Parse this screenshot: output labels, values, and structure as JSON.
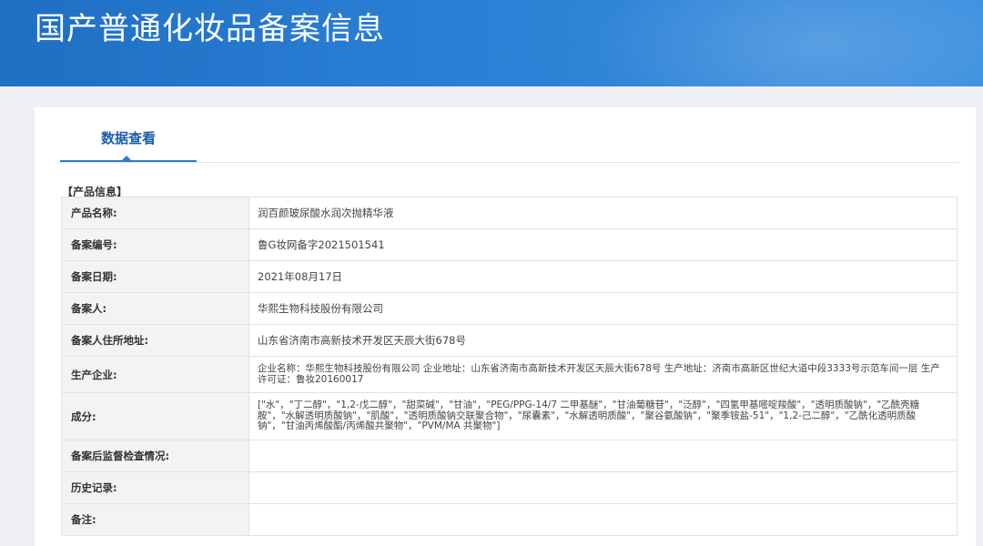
{
  "header": {
    "title": "国产普通化妆品备案信息"
  },
  "tabs": [
    {
      "label": "数据查看"
    }
  ],
  "section": {
    "title": "【产品信息】"
  },
  "rows": [
    {
      "label": "产品名称:",
      "value": "润百颜玻尿酸水润次抛精华液"
    },
    {
      "label": "备案编号:",
      "value": "鲁G妆网备字2021501541"
    },
    {
      "label": "备案日期:",
      "value": "2021年08月17日"
    },
    {
      "label": "备案人:",
      "value": "华熙生物科技股份有限公司"
    },
    {
      "label": "备案人住所地址:",
      "value": "山东省济南市高新技术开发区天辰大街678号"
    },
    {
      "label": "生产企业:",
      "value": "企业名称：华熙生物科技股份有限公司 企业地址：山东省济南市高新技术开发区天辰大街678号 生产地址：济南市高新区世纪大道中段3333号示范车间一层 生产许可证：鲁妆20160017"
    },
    {
      "label": "成分:",
      "value": "[\"水\"，\"丁二醇\"，\"1,2-戊二醇\"，\"甜菜碱\"，\"甘油\"，\"PEG/PPG-14/7 二甲基醚\"，\"甘油葡糖苷\"，\"泛醇\"，\"四氢甲基嘧啶羧酸\"，\"透明质酸钠\"，\"乙酰壳糖胺\"，\"水解透明质酸钠\"，\"肌酸\"，\"透明质酸钠交联聚合物\"，\"尿囊素\"，\"水解透明质酸\"，\"聚谷氨酸钠\"，\"聚季铵盐-51\"，\"1,2-己二醇\"，\"乙酰化透明质酸钠\"，\"甘油丙烯酸酯/丙烯酸共聚物\"，\"PVM/MA 共聚物\"]"
    },
    {
      "label": "备案后监督检查情况:",
      "value": ""
    },
    {
      "label": "历史记录:",
      "value": ""
    },
    {
      "label": "备注:",
      "value": ""
    }
  ]
}
